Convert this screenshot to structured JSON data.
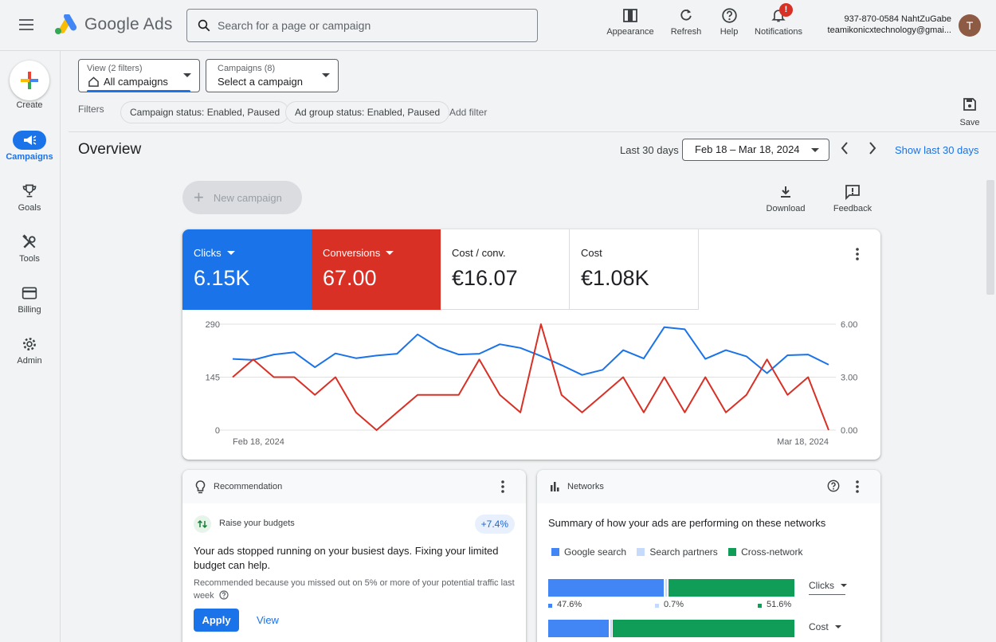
{
  "app": {
    "product_name": "Google Ads",
    "search_placeholder": "Search for a page or campaign"
  },
  "toolbar": {
    "appearance": "Appearance",
    "refresh": "Refresh",
    "help": "Help",
    "notifications": "Notifications",
    "notifications_badge": "!"
  },
  "account": {
    "line1": "937-870-0584 NahtZuGabe",
    "line2": "teamikonicxtechnology@gmai...",
    "avatar_initial": "T"
  },
  "nav": {
    "create": "Create",
    "items": [
      {
        "label": "Campaigns",
        "icon": "campaigns-megaphone-icon",
        "active": true
      },
      {
        "label": "Goals",
        "icon": "trophy-icon"
      },
      {
        "label": "Tools",
        "icon": "tools-icon"
      },
      {
        "label": "Billing",
        "icon": "credit-card-icon"
      },
      {
        "label": "Admin",
        "icon": "gear-icon"
      }
    ]
  },
  "filters": {
    "view_small": "View (2 filters)",
    "view_value": "All campaigns",
    "campaigns_small": "Campaigns (8)",
    "campaigns_value": "Select a campaign",
    "label": "Filters",
    "chips": [
      "Campaign status: Enabled, Paused",
      "Ad group status: Enabled, Paused"
    ],
    "add_filter": "Add filter",
    "save": "Save"
  },
  "overview": {
    "title": "Overview",
    "range_label": "Last 30 days",
    "date_range": "Feb 18 – Mar 18, 2024",
    "show_last": "Show last 30 days",
    "new_campaign": "New campaign",
    "download": "Download",
    "feedback": "Feedback"
  },
  "metrics": [
    {
      "label": "Clicks",
      "value": "6.15K",
      "bg": "#1a73e8",
      "fg": "#ffffff",
      "dropdown": true
    },
    {
      "label": "Conversions",
      "value": "67.00",
      "bg": "#d93025",
      "fg": "#ffffff",
      "dropdown": true
    },
    {
      "label": "Cost / conv.",
      "value": "€16.07",
      "bg": "#ffffff",
      "fg": "#202124",
      "dropdown": false
    },
    {
      "label": "Cost",
      "value": "€1.08K",
      "bg": "#ffffff",
      "fg": "#202124",
      "dropdown": false
    }
  ],
  "chart_data": {
    "type": "line",
    "x_labels": {
      "start": "Feb 18, 2024",
      "end": "Mar 18, 2024"
    },
    "left_axis": {
      "ticks": [
        "290",
        "145",
        "0"
      ],
      "ylim": [
        0,
        290
      ]
    },
    "right_axis": {
      "ticks": [
        "6.00",
        "3.00",
        "0.00"
      ],
      "ylim": [
        0,
        6
      ]
    },
    "grid": true,
    "series": [
      {
        "color": "#1a73e8",
        "axis": "left",
        "values": [
          195,
          192,
          207,
          213,
          172,
          210,
          197,
          204,
          209,
          262,
          227,
          207,
          209,
          235,
          225,
          203,
          178,
          151,
          165,
          219,
          196,
          282,
          276,
          195,
          219,
          202,
          156,
          205,
          207,
          179
        ]
      },
      {
        "color": "#d93025",
        "axis": "right",
        "values": [
          3.0,
          4.0,
          3.0,
          3.0,
          2.0,
          3.0,
          1.0,
          0.0,
          1.0,
          2.0,
          2.0,
          2.0,
          4.0,
          2.0,
          1.0,
          6.0,
          2.0,
          1.0,
          2.0,
          3.0,
          1.0,
          3.0,
          1.0,
          3.0,
          1.0,
          2.0,
          4.0,
          2.0,
          3.0,
          0.0
        ]
      }
    ]
  },
  "recommendation": {
    "header": "Recommendation",
    "item_title": "Raise your budgets",
    "pct": "+7.4%",
    "body": "Your ads stopped running on your busiest days. Fixing your limited budget can help.",
    "reason": "Recommended because you missed out on 5% or more of your potential traffic last week",
    "apply": "Apply",
    "view": "View"
  },
  "networks": {
    "header": "Networks",
    "summary": "Summary of how your ads are performing on these networks",
    "legend": [
      {
        "label": "Google search",
        "color": "#4285f4"
      },
      {
        "label": "Search partners",
        "color": "#c6dafc"
      },
      {
        "label": "Cross-network",
        "color": "#0f9d58"
      }
    ],
    "rows": [
      {
        "metric": "Clicks",
        "shares": [
          47.6,
          0.7,
          51.6
        ],
        "labels": [
          "47.6%",
          "0.7%",
          "51.6%"
        ]
      },
      {
        "metric": "Cost",
        "shares": [
          25.0,
          0.3,
          74.7
        ],
        "labels": [
          "",
          "",
          ""
        ]
      }
    ]
  }
}
